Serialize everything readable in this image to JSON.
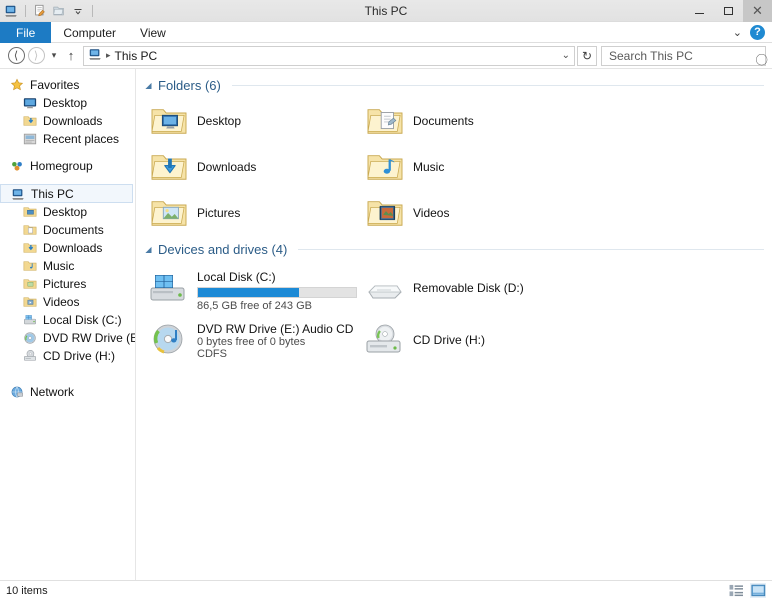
{
  "window": {
    "title": "This PC",
    "quick_access": [
      {
        "name": "this-pc-icon",
        "label": "This PC"
      },
      {
        "name": "properties-icon",
        "label": "Properties"
      },
      {
        "name": "new-folder-icon",
        "label": "New folder"
      },
      {
        "name": "customize-quick-access-icon",
        "label": "Customize Quick Access Toolbar"
      }
    ],
    "controls": {
      "minimize": "Minimize",
      "maximize": "Maximize",
      "close": "Close",
      "close_glyph": "✕"
    }
  },
  "ribbon": {
    "tabs": [
      {
        "label": "File",
        "active": true
      },
      {
        "label": "Computer",
        "active": false
      },
      {
        "label": "View",
        "active": false
      }
    ],
    "expand_label": "⌄",
    "help_label": "?"
  },
  "address": {
    "back_label": "◄",
    "forward_label": "►",
    "recent_label": "⌄",
    "up_label": "↑",
    "crumb_icon": "this-pc-icon",
    "crumb_sep": "▸",
    "crumb_text": "This PC",
    "dropdown_label": "⌄",
    "refresh_label": "↻"
  },
  "search": {
    "placeholder": "Search This PC",
    "value": "",
    "icon_label": "search-icon"
  },
  "sidebar": {
    "groups": [
      {
        "items": [
          {
            "label": "Favorites",
            "icon": "star-icon",
            "level": "root",
            "selected": false
          },
          {
            "label": "Desktop",
            "icon": "desktop-icon",
            "level": "child",
            "selected": false
          },
          {
            "label": "Downloads",
            "icon": "downloads-folder-icon",
            "level": "child",
            "selected": false
          },
          {
            "label": "Recent places",
            "icon": "recent-places-icon",
            "level": "child",
            "selected": false
          }
        ]
      },
      {
        "items": [
          {
            "label": "Homegroup",
            "icon": "homegroup-icon",
            "level": "root",
            "selected": false
          }
        ]
      },
      {
        "items": [
          {
            "label": "This PC",
            "icon": "this-pc-icon",
            "level": "root",
            "selected": true
          },
          {
            "label": "Desktop",
            "icon": "desktop-folder-icon",
            "level": "child",
            "selected": false
          },
          {
            "label": "Documents",
            "icon": "documents-folder-icon",
            "level": "child",
            "selected": false
          },
          {
            "label": "Downloads",
            "icon": "downloads-folder-icon",
            "level": "child",
            "selected": false
          },
          {
            "label": "Music",
            "icon": "music-folder-icon",
            "level": "child",
            "selected": false
          },
          {
            "label": "Pictures",
            "icon": "pictures-folder-icon",
            "level": "child",
            "selected": false
          },
          {
            "label": "Videos",
            "icon": "videos-folder-icon",
            "level": "child",
            "selected": false
          },
          {
            "label": "Local Disk (C:)",
            "icon": "hard-drive-icon",
            "level": "child",
            "selected": false
          },
          {
            "label": "DVD RW Drive (E:) A",
            "icon": "optical-drive-icon",
            "level": "child",
            "selected": false
          },
          {
            "label": "CD Drive (H:)",
            "icon": "cd-drive-icon",
            "level": "child",
            "selected": false
          }
        ]
      },
      {
        "items": [
          {
            "label": "Network",
            "icon": "network-icon",
            "level": "root",
            "selected": false
          }
        ]
      }
    ]
  },
  "content": {
    "folders_group": {
      "chevron": "◢",
      "title": "Folders (6)",
      "items": [
        {
          "label": "Desktop",
          "icon": "desktop-folder-icon"
        },
        {
          "label": "Documents",
          "icon": "documents-folder-icon"
        },
        {
          "label": "Downloads",
          "icon": "downloads-folder-icon"
        },
        {
          "label": "Music",
          "icon": "music-folder-icon"
        },
        {
          "label": "Pictures",
          "icon": "pictures-folder-icon"
        },
        {
          "label": "Videos",
          "icon": "videos-folder-icon"
        }
      ]
    },
    "devices_group": {
      "chevron": "◢",
      "title": "Devices and drives (4)",
      "items": [
        {
          "label": "Local Disk (C:)",
          "icon": "windows-hard-drive-icon",
          "has_bar": true,
          "bar_percent": 64,
          "bar_color": "#1c8ad6",
          "sub1": "86,5 GB free of 243 GB",
          "sub2": ""
        },
        {
          "label": "Removable Disk (D:)",
          "icon": "removable-disk-icon",
          "has_bar": false,
          "bar_percent": 0,
          "bar_color": "",
          "sub1": "",
          "sub2": ""
        },
        {
          "label": "DVD RW Drive (E:) Audio CD",
          "icon": "audio-cd-icon",
          "has_bar": false,
          "bar_percent": 0,
          "bar_color": "",
          "sub1": "0 bytes free of 0 bytes",
          "sub2": "CDFS"
        },
        {
          "label": "CD Drive (H:)",
          "icon": "cd-drive-icon",
          "has_bar": false,
          "bar_percent": 0,
          "bar_color": "",
          "sub1": "",
          "sub2": ""
        }
      ]
    }
  },
  "statusbar": {
    "item_count": "10 items",
    "views": [
      {
        "name": "details-view-button",
        "label": "Details view",
        "active": false
      },
      {
        "name": "large-icons-view-button",
        "label": "Large icons view",
        "active": true
      }
    ]
  },
  "colors": {
    "accent": "#1d7bc4",
    "group_title": "#2b5c87",
    "progress": "#1c8ad6",
    "selection": "#f2f7fc"
  }
}
